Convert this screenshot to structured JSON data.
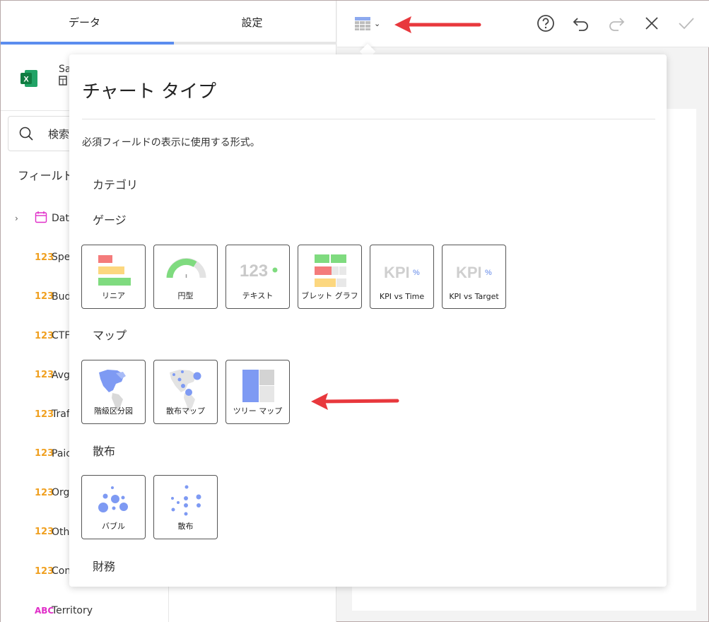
{
  "tabs": {
    "data": "データ",
    "settings": "設定"
  },
  "source": {
    "name": "Sa",
    "sub": ""
  },
  "search": {
    "placeholder": "検索"
  },
  "fields_heading": "フィールド",
  "fields": [
    {
      "type": "date",
      "name": "Dat",
      "expandable": true
    },
    {
      "type": "123",
      "name": "Spe"
    },
    {
      "type": "123",
      "name": "Bud"
    },
    {
      "type": "123",
      "name": "CTF"
    },
    {
      "type": "123",
      "name": "Avg"
    },
    {
      "type": "123",
      "name": "Traf"
    },
    {
      "type": "123",
      "name": "Paic"
    },
    {
      "type": "123",
      "name": "Org"
    },
    {
      "type": "123",
      "name": "Oth"
    },
    {
      "type": "123",
      "name": "Con"
    },
    {
      "type": "ABC",
      "name": "Territory"
    }
  ],
  "toolbar": {
    "visualization_icon": "grid-table-icon",
    "help_icon": "help-icon",
    "undo_icon": "undo-icon",
    "redo_icon": "redo-icon",
    "close_icon": "close-icon",
    "confirm_icon": "check-icon"
  },
  "popup": {
    "title": "チャート タイプ",
    "description": "必須フィールドの表示に使用する形式。",
    "categories": {
      "category": "カテゴリ",
      "gauge": "ゲージ",
      "map": "マップ",
      "scatter": "散布",
      "financial": "財務"
    },
    "gauges": [
      {
        "label": "リニア",
        "icon": "linear-gauge-icon"
      },
      {
        "label": "円型",
        "icon": "circular-gauge-icon"
      },
      {
        "label": "テキスト",
        "icon": "text-gauge-icon"
      },
      {
        "label": "ブレット グラフ",
        "icon": "bullet-graph-icon"
      },
      {
        "label": "KPI vs Time",
        "icon": "kpi-time-icon"
      },
      {
        "label": "KPI vs Target",
        "icon": "kpi-target-icon"
      }
    ],
    "maps": [
      {
        "label": "階級区分図",
        "icon": "choropleth-map-icon"
      },
      {
        "label": "散布マップ",
        "icon": "scatter-map-icon"
      },
      {
        "label": "ツリー マップ",
        "icon": "treemap-icon"
      }
    ],
    "scatters": [
      {
        "label": "バブル",
        "icon": "bubble-chart-icon"
      },
      {
        "label": "散布",
        "icon": "scatter-chart-icon"
      }
    ],
    "icon_text": {
      "text_gauge": "123",
      "kpi": "KPI",
      "percent": "%"
    }
  },
  "colors": {
    "accent": "#5b8def",
    "arrow": "#e8383d",
    "gauge_red": "#f47b7b",
    "gauge_yellow": "#fcd77f",
    "gauge_green": "#7fdb7f",
    "map_blue": "#7e9af3",
    "field_number": "#f0a020",
    "field_text": "#e02ec8"
  }
}
